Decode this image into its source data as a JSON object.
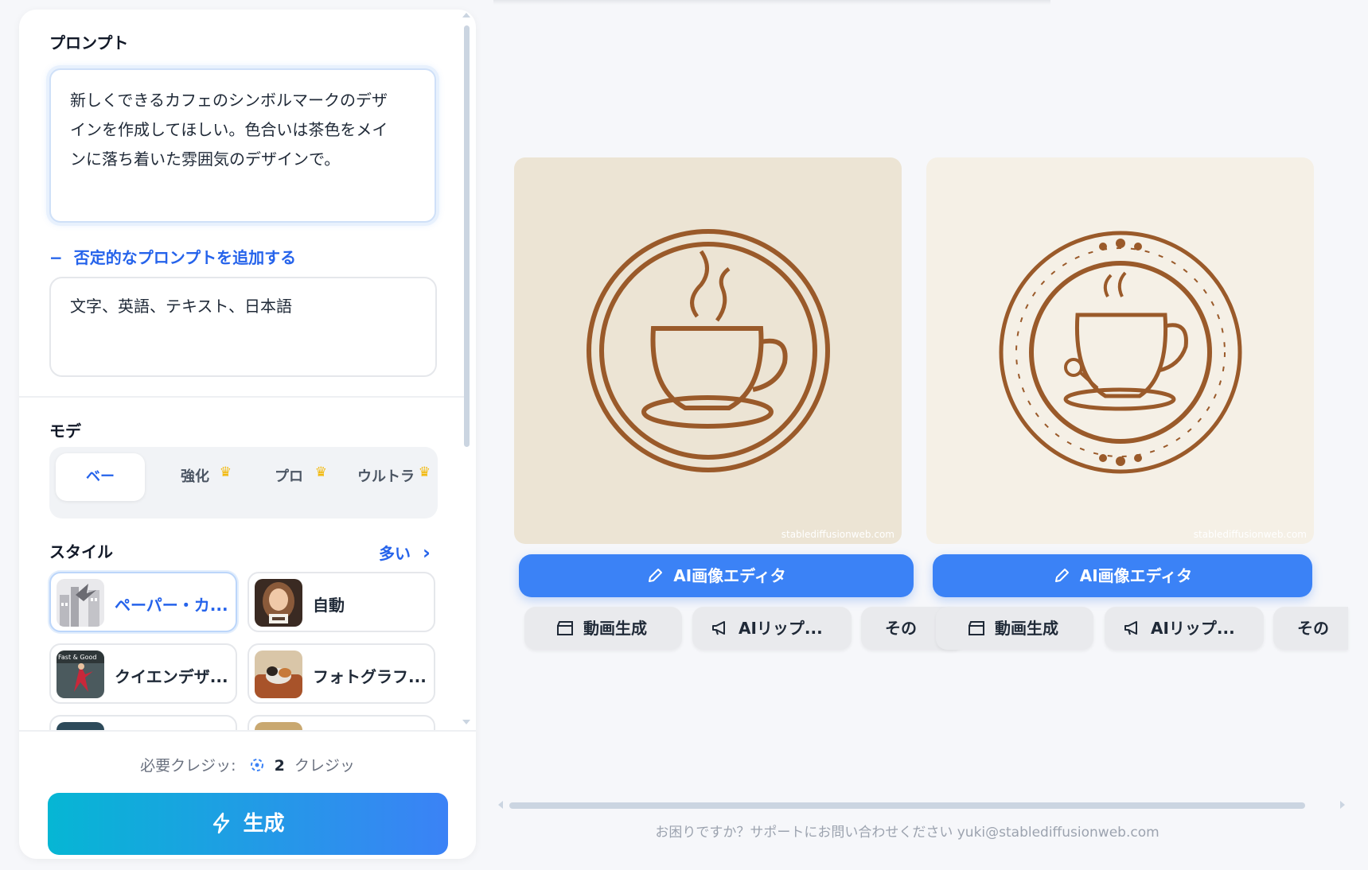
{
  "prompt": {
    "title": "プロンプト",
    "value": "新しくできるカフェのシンボルマークのデザインを作成してほしい。色合いは茶色をメインに落ち着いた雰囲気のデザインで。",
    "lines": [
      "新しくできるカフェのシンボルマークのデザ",
      "インを作成してほしい。色合いは茶色をメイ",
      "ンに落ち着いた雰囲気のデザインで。"
    ]
  },
  "negative": {
    "toggle_icon": "−",
    "toggle_label": "否定的なプロンプトを追加する",
    "value": "文字、英語、テキスト、日本語"
  },
  "mode": {
    "title": "モデ",
    "options": [
      {
        "label": "ベー",
        "active": true,
        "premium": false
      },
      {
        "label": "強化",
        "active": false,
        "premium": true
      },
      {
        "label": "プロ",
        "active": false,
        "premium": true
      },
      {
        "label": "ウルトラ",
        "active": false,
        "premium": true
      }
    ],
    "crown_glyph": "♛"
  },
  "style": {
    "title": "スタイル",
    "more_label": "多い",
    "more_icon": "›",
    "items": [
      {
        "label": "ペーパー・カ...",
        "active": true,
        "thumb": "paper-art-thumbnail"
      },
      {
        "label": "自動",
        "active": false,
        "thumb": "girl-portrait-thumbnail"
      },
      {
        "label": "クイエンデザ...",
        "active": false,
        "thumb": "dancer-magazine-thumbnail"
      },
      {
        "label": "フォトグラフ...",
        "active": false,
        "thumb": "dog-photo-thumbnail"
      }
    ],
    "thumb_overlay_text": "Fast & Good"
  },
  "footer": {
    "credits_label": "必要クレジッ:",
    "credits_value": "2",
    "credits_unit": "クレジッ",
    "generate_label": "生成",
    "generate_icon": "lightning-icon"
  },
  "results": [
    {
      "watermark": "stablediffusionweb.com",
      "editor_label": "AI画像エディタ",
      "actions": [
        "動画生成",
        "AIリップ...",
        "その"
      ]
    },
    {
      "watermark": "stablediffusionweb.com",
      "editor_label": "AI画像エディタ",
      "actions": [
        "動画生成",
        "AIリップ...",
        "その"
      ]
    }
  ],
  "support_text": "お困りですか？サポートにお問い合わせください yuki@stablediffusionweb.com",
  "colors": {
    "accent": "#3b82f6",
    "link": "#2563eb",
    "crown": "#f2b705",
    "coffee": "#9a5a2a",
    "paper1": "#ece4d4",
    "paper2": "#f5f0e6"
  }
}
